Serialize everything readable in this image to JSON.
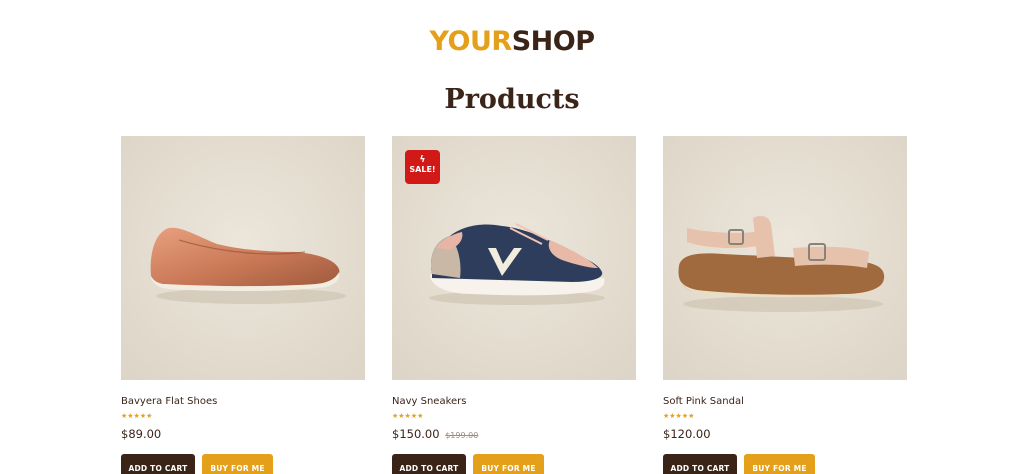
{
  "brand": {
    "part1": "YOUR",
    "part2": "SHOP",
    "color_primary": "#e5a01b",
    "color_dark": "#3a2417"
  },
  "page": {
    "title": "Products"
  },
  "products": [
    {
      "name": "Bavyera Flat Shoes",
      "rating": 5,
      "rating_stars": "★★★★★",
      "price": "$89.00",
      "old_price": "",
      "sale_badge": "",
      "image_icon": "flat-shoe",
      "add_to_cart": "ADD TO CART",
      "buy_now": "BUY FOR ME"
    },
    {
      "name": "Navy Sneakers",
      "rating": 5,
      "rating_stars": "★★★★★",
      "price": "$150.00",
      "old_price": "$199.00",
      "sale_badge": "SALE!",
      "image_icon": "sneaker",
      "add_to_cart": "ADD TO CART",
      "buy_now": "BUY FOR ME"
    },
    {
      "name": "Soft Pink Sandal",
      "rating": 5,
      "rating_stars": "★★★★★",
      "price": "$120.00",
      "old_price": "",
      "sale_badge": "",
      "image_icon": "sandal",
      "add_to_cart": "ADD TO CART",
      "buy_now": "BUY FOR ME"
    }
  ],
  "colors": {
    "sale": "#d11a17",
    "image_bg": "#e7e1d5",
    "text": "#3b2418"
  }
}
